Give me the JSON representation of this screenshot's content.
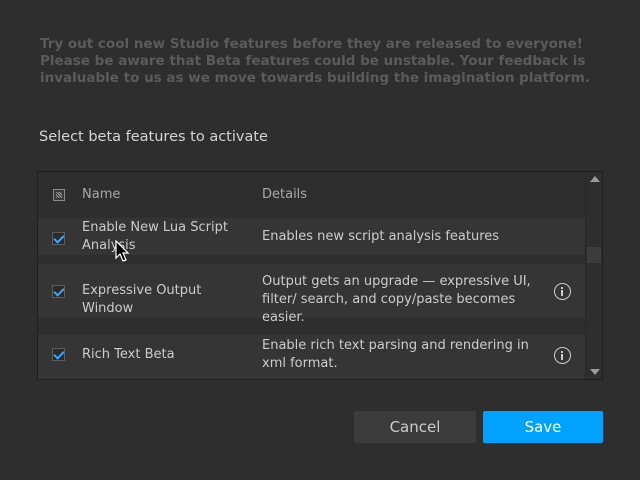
{
  "intro": {
    "text": "Try out cool new Studio features before they are released to everyone! Please be aware that Beta features could be unstable. Your feedback is invaluable to us as we move towards building the imagination platform."
  },
  "select_label": "Select beta features to activate",
  "table": {
    "header": {
      "name": "Name",
      "details": "Details"
    },
    "rows": [
      {
        "name": "Enable New Lua Script Analysis",
        "details": "Enables new script analysis features",
        "checked": true,
        "info": false
      },
      {
        "name": "Expressive Output Window",
        "details": "Output gets an upgrade — expressive UI, filter/ search, and copy/paste becomes easier.",
        "checked": true,
        "info": true
      },
      {
        "name": "Rich Text Beta",
        "details": "Enable rich text parsing and rendering in xml format.",
        "checked": true,
        "info": true
      }
    ]
  },
  "buttons": {
    "cancel": "Cancel",
    "save": "Save"
  },
  "colors": {
    "background": "#2e2e2e",
    "accent": "#00a2ff",
    "checkmark": "#3da6ff"
  }
}
